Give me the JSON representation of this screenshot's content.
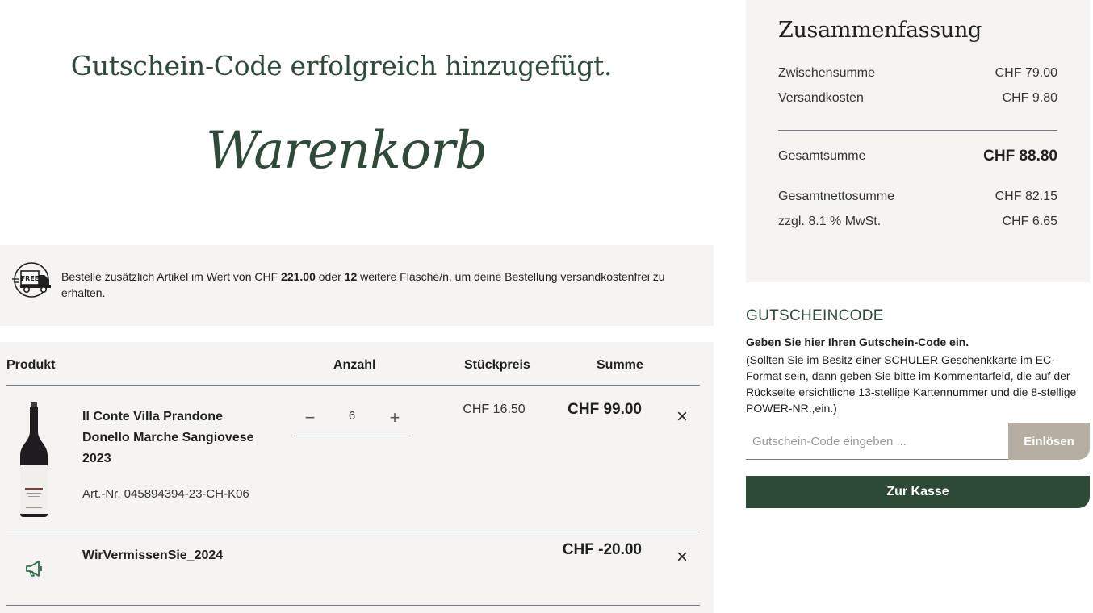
{
  "success_message": "Gutschein-Code erfolgreich hinzugefügt.",
  "cart_title": "Warenkorb",
  "free_shipping": {
    "icon": "free-shipping-truck-icon",
    "icon_label": "FREE",
    "text_before": "Bestelle zusätzlich Artikel im Wert von CHF ",
    "amount": "221.00",
    "text_middle": " oder ",
    "bottles": "12",
    "text_after": " weitere Flasche/n, um deine Bestellung versandkostenfrei zu erhalten."
  },
  "table": {
    "headers": {
      "product": "Produkt",
      "quantity": "Anzahl",
      "unit_price": "Stückpreis",
      "total": "Summe"
    }
  },
  "items": [
    {
      "name": "Il Conte Villa Prandone Donello Marche Sangiovese 2023",
      "article": "Art.-Nr. 045894394-23-CH-K06",
      "quantity": "6",
      "minus": "−",
      "plus": "+",
      "unit_price": "CHF 16.50",
      "total": "CHF 99.00",
      "remove": "×"
    }
  ],
  "promo": {
    "icon": "megaphone-icon",
    "name": "WirVermissenSie_2024",
    "total": "CHF -20.00",
    "remove": "×"
  },
  "summary": {
    "title": "Zusammenfassung",
    "subtotal_label": "Zwischensumme",
    "subtotal": "CHF 79.00",
    "shipping_label": "Versandkosten",
    "shipping": "CHF 9.80",
    "grand_total_label": "Gesamtsumme",
    "grand_total": "CHF 88.80",
    "net_total_label": "Gesamtnettosumme",
    "net_total": "CHF 82.15",
    "vat_label": "zzgl. 8.1 % MwSt.",
    "vat": "CHF 6.65"
  },
  "voucher": {
    "heading": "GUTSCHEINCODE",
    "subheading": "Geben Sie hier Ihren Gutschein-Code ein.",
    "note": "(Sollten Sie im Besitz einer SCHULER Geschenkkarte im EC-Format sein, dann geben Sie bitte im Kommentarfeld, die auf der Rückseite ersichtliche 13-stellige Kartennummer und die 8-stellige POWER-NR.,ein.)",
    "placeholder": "Gutschein-Code eingeben ...",
    "redeem_label": "Einlösen"
  },
  "checkout_label": "Zur Kasse",
  "colors": {
    "accent": "#2d4a37",
    "panel": "#f5f4f2",
    "redeem": "#b7aea3"
  }
}
